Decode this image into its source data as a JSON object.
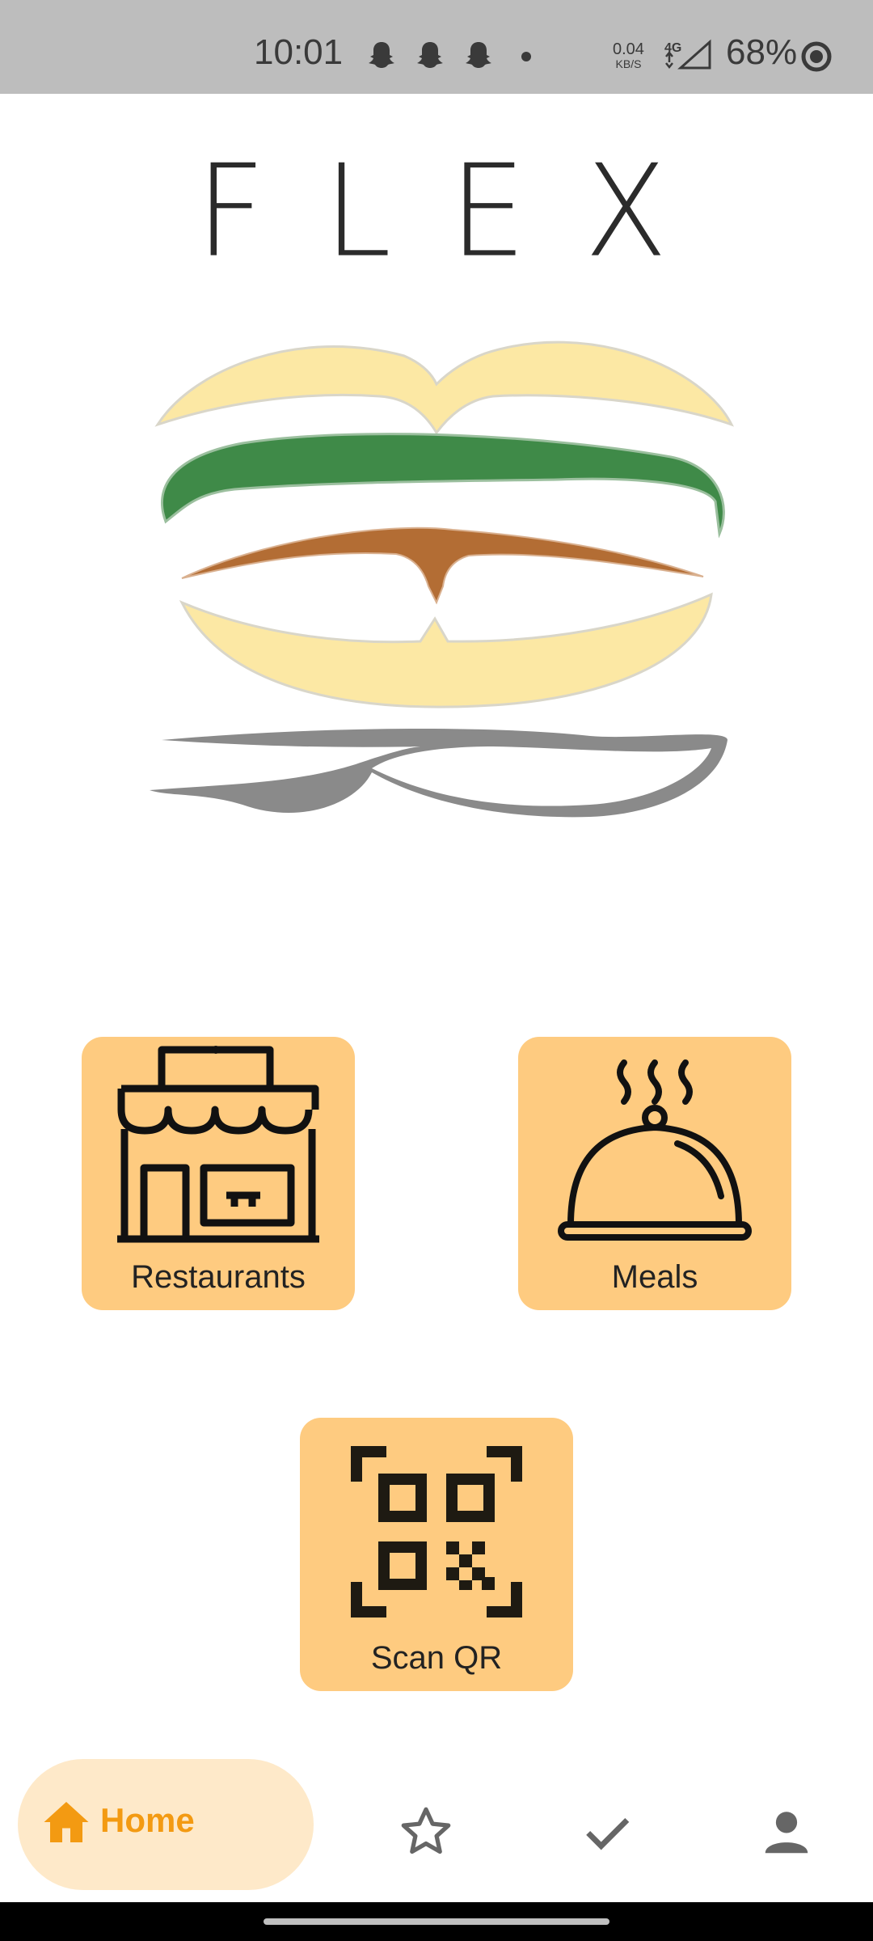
{
  "status_bar": {
    "time": "10:01",
    "net_speed": "0.04",
    "net_unit": "KB/S",
    "network_type": "4G",
    "battery": "68%"
  },
  "brand": {
    "title": "FLEX"
  },
  "tiles": {
    "restaurants": "Restaurants",
    "meals": "Meals",
    "scan_qr": "Scan QR"
  },
  "nav": {
    "home": "Home",
    "active_color": "#f39a12",
    "active_bg": "#fee9c9"
  },
  "colors": {
    "tile_bg": "#fecb80",
    "bun": "#fce8a4",
    "lettuce": "#3f8a48",
    "patty": "#b36d34",
    "plate": "#8a8a8a"
  }
}
